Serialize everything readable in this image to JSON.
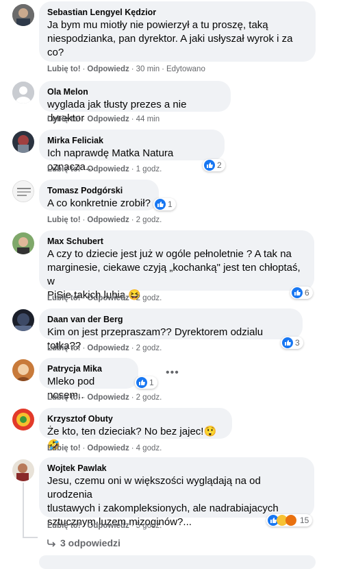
{
  "comments": [
    {
      "name": "Sebastian Lengyel Kędzior",
      "lines": [
        "Ja bym mu miotły nie powierzył a tu proszę, taką",
        "niespodzianka, pan dyrektor. A jaki usłyszał wyrok i za",
        "co?"
      ],
      "like": "Lubię to!",
      "reply": "Odpowiedz",
      "time": "30 min",
      "extra": "Edytowano",
      "reactions": ""
    },
    {
      "name": "Ola Melon",
      "lines": [
        "wyglada jak tłusty prezes a nie dyrektor"
      ],
      "like": "Lubię to!",
      "reply": "Odpowiedz",
      "time": "44 min",
      "reactions": ""
    },
    {
      "name": "Mirka Feliciak",
      "lines": [
        "Ich naprawdę Matka Natura oznacza..."
      ],
      "like": "Lubię to!",
      "reply": "Odpowiedz",
      "time": "1 godz.",
      "reactions": "2"
    },
    {
      "name": "Tomasz Podgórski",
      "lines": [
        "A co konkretnie zrobił?"
      ],
      "like": "Lubię to!",
      "reply": "Odpowiedz",
      "time": "2 godz.",
      "reactions": "1"
    },
    {
      "name": "Max Schubert",
      "lines": [
        "A czy to dziecie jest już w ogóle pełnoletnie ? A tak na",
        "marginesie, ciekawe czyją „kochanką\" jest ten chłoptaś, w",
        "PiSie takich lubią 😆"
      ],
      "like": "Lubię to!",
      "reply": "Odpowiedz",
      "time": "2 godz.",
      "reactions": "6"
    },
    {
      "name": "Daan van der Berg",
      "lines": [
        "Kim on jest przepraszam?? Dyrektorem odzialu totka??"
      ],
      "like": "Lubię to!",
      "reply": "Odpowiedz",
      "time": "2 godz.",
      "reactions": "3"
    },
    {
      "name": "Patrycja Mika",
      "lines": [
        "Mleko pod nosem.."
      ],
      "like": "Lubię to!",
      "reply": "Odpowiedz",
      "time": "2 godz.",
      "reactions": "1"
    },
    {
      "name": "Krzysztof Obuty",
      "lines": [
        "Że kto, ten dzieciak? No bez jajec!😲🤣"
      ],
      "like": "Lubię to!",
      "reply": "Odpowiedz",
      "time": "4 godz.",
      "reactions": ""
    },
    {
      "name": "Wojtek Pawlak",
      "lines": [
        "Jesu, czemu oni w większości wyglądają na od urodzenia",
        "tlustawych i zakompleksionych, ale nadrabiajacych",
        "sztucznym luzem mizoginów?..."
      ],
      "like": "Lubię to!",
      "reply": "Odpowiedz",
      "time": "5 godz.",
      "reactions": "15"
    }
  ],
  "more_replies": "3 odpowiedzi",
  "colors": {
    "like_blue": "#1877f2",
    "bubble": "#f0f2f5",
    "meta": "#65676b"
  },
  "icons": {
    "like": "thumbs-up-icon",
    "reply_arrow": "reply-arrow-icon",
    "more": "more-options-icon"
  }
}
